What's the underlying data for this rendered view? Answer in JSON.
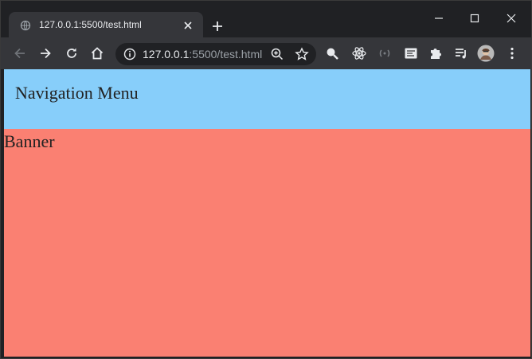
{
  "browser": {
    "tab": {
      "title": "127.0.0.1:5500/test.html"
    },
    "address_bar": {
      "host": "127.0.0.1",
      "path": ":5500/test.html"
    },
    "colors": {
      "frame": "#202124",
      "toolbar": "#35363a",
      "text": "#e8eaed",
      "muted": "#9aa0a6"
    },
    "icons": [
      "globe-icon",
      "close-icon",
      "plus-icon",
      "minimize-icon",
      "maximize-icon",
      "close-window-icon",
      "back-icon",
      "forward-icon",
      "reload-icon",
      "home-icon",
      "info-icon",
      "zoom-icon",
      "star-icon",
      "search-extension-icon",
      "react-devtools-icon",
      "extension-icon",
      "reader-icon",
      "puzzle-icon",
      "media-queue-icon",
      "avatar",
      "kebab-menu-icon"
    ]
  },
  "page": {
    "nav": {
      "title": "Navigation Menu",
      "color": "#87cefa"
    },
    "banner": {
      "title": "Banner",
      "color": "#fa8072"
    }
  }
}
